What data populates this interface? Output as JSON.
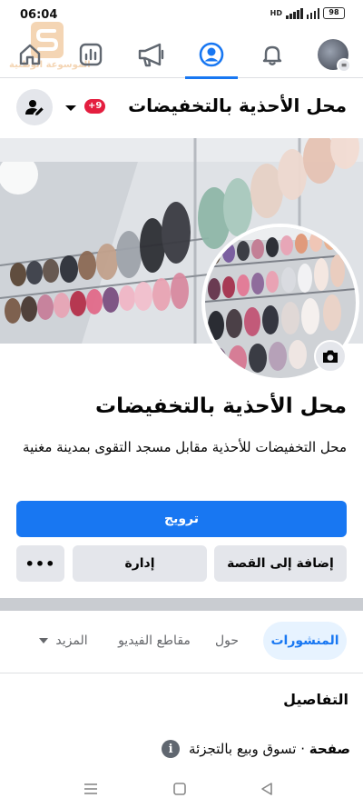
{
  "status_bar": {
    "time": "06:04",
    "network": "HD",
    "battery": "98"
  },
  "watermark": {
    "text": "الموسوعة الوطنية"
  },
  "top_nav": {
    "items": [
      {
        "name": "home",
        "icon": "home-icon"
      },
      {
        "name": "insights",
        "icon": "chart-icon"
      },
      {
        "name": "ads",
        "icon": "megaphone-icon"
      },
      {
        "name": "profile",
        "icon": "profile-icon",
        "active": true
      },
      {
        "name": "notifications",
        "icon": "bell-icon"
      },
      {
        "name": "menu",
        "icon": "avatar-menu-icon"
      }
    ],
    "accent_color": "#1877f2"
  },
  "page_header": {
    "title": "محل الأحذية  بالتخفيضات",
    "badge": "+9"
  },
  "page": {
    "name": "محل الأحذية  بالتخفيضات",
    "bio": "محل التخفيضات للأحذية مقابل مسجد التقوى بمدينة مغنية"
  },
  "actions": {
    "promote": "ترويج",
    "add_to_story": "إضافة إلى القصة",
    "manage": "إدارة",
    "more": "•••"
  },
  "tabs": {
    "posts": "المنشورات",
    "about": "حول",
    "videos": "مقاطع الفيديو",
    "more": "المزيد"
  },
  "details": {
    "heading": "التفاصيل",
    "category_label": "صفحة",
    "category_separator": " · ",
    "category_value": "تسوق وبيع بالتجزئة"
  }
}
